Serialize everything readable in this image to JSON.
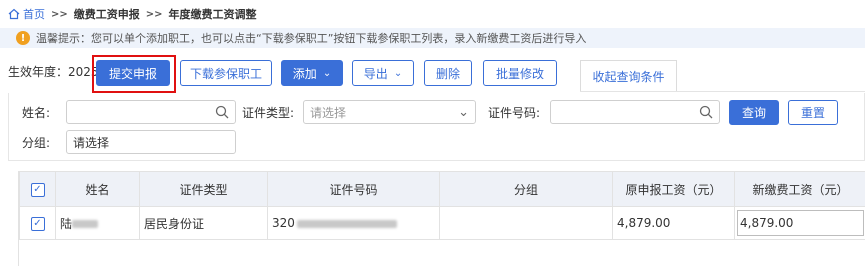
{
  "breadcrumb": {
    "home": "首页",
    "sep": ">>",
    "item1": "缴费工资申报",
    "item2": "年度缴费工资调整"
  },
  "tip": {
    "icon": "!",
    "text": "温馨提示：您可以单个添加职工，也可以点击“下载参保职工”按钮下载参保职工列表，录入新缴费工资后进行导入"
  },
  "toolbar": {
    "year_label": "生效年度：",
    "year_value": "2025",
    "submit": "提交申报",
    "download": "下载参保职工",
    "add": "添加",
    "export": "导出",
    "delete": "删除",
    "batch_edit": "批量修改",
    "collapse_tab": "收起查询条件"
  },
  "search": {
    "name_label": "姓名:",
    "idtype_label": "证件类型:",
    "idtype_placeholder": "请选择",
    "idno_label": "证件号码:",
    "group_label": "分组:",
    "group_value": "请选择",
    "query": "查询",
    "reset": "重置"
  },
  "table": {
    "headers": [
      "姓名",
      "证件类型",
      "证件号码",
      "分组",
      "原申报工资（元）",
      "新缴费工资（元）"
    ],
    "rows": [
      {
        "name": "陆",
        "id_type": "居民身份证",
        "id_no": "320",
        "group": "",
        "old_wage": "4,879.00",
        "new_wage": "4,879.00"
      }
    ]
  },
  "colors": {
    "accent": "#3a6fd8",
    "highlight": "#e01010",
    "tip_icon": "#f0a020"
  }
}
